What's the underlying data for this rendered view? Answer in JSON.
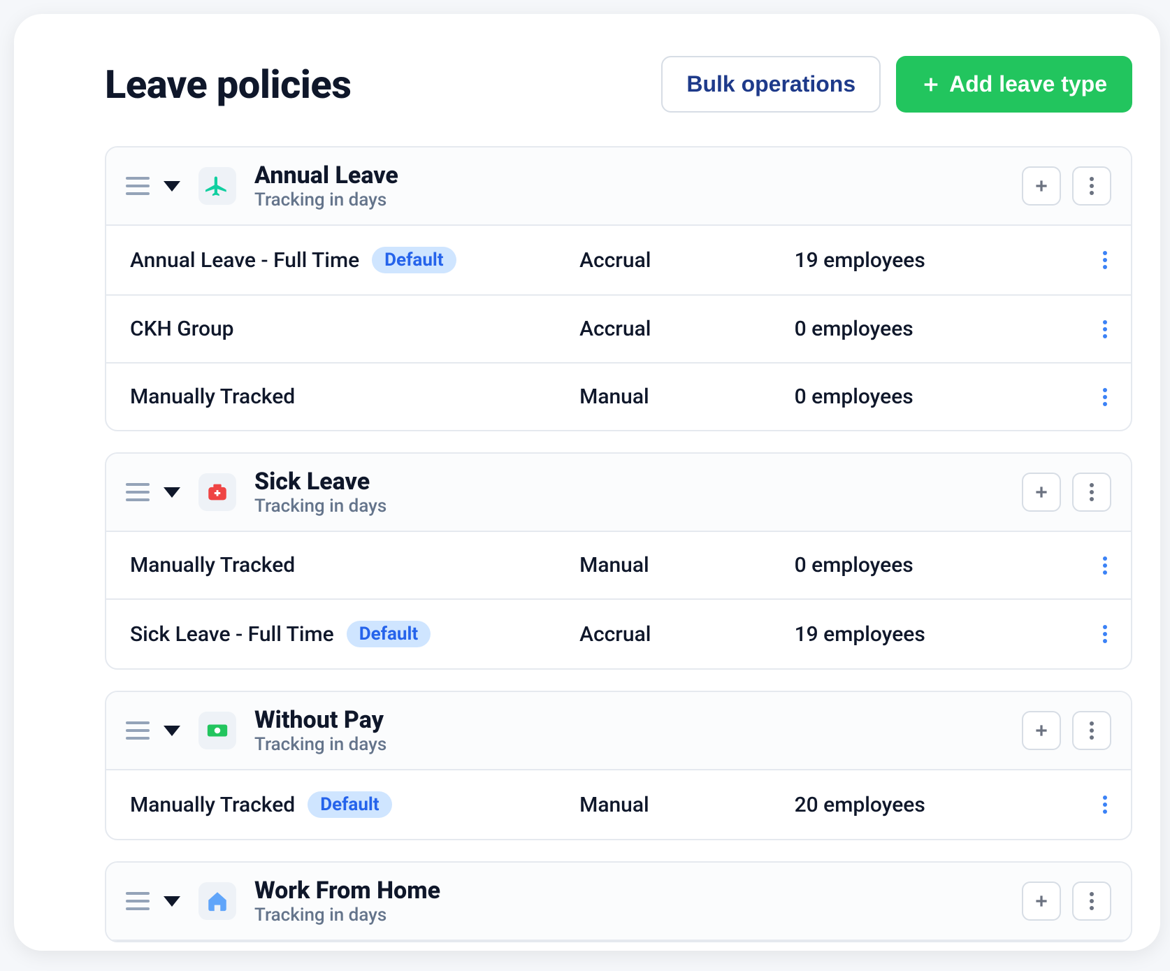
{
  "header": {
    "title": "Leave policies",
    "bulk_ops_label": "Bulk operations",
    "add_type_label": "Add leave type"
  },
  "badges": {
    "default": "Default"
  },
  "types": [
    {
      "title": "Annual Leave",
      "subtitle": "Tracking in days",
      "icon": "plane",
      "rows": [
        {
          "name": "Annual Leave - Full Time",
          "default": true,
          "method": "Accrual",
          "employees": "19 employees"
        },
        {
          "name": "CKH Group",
          "default": false,
          "method": "Accrual",
          "employees": "0 employees"
        },
        {
          "name": "Manually Tracked",
          "default": false,
          "method": "Manual",
          "employees": "0 employees"
        }
      ]
    },
    {
      "title": "Sick Leave",
      "subtitle": "Tracking in days",
      "icon": "medkit",
      "rows": [
        {
          "name": "Manually Tracked",
          "default": false,
          "method": "Manual",
          "employees": "0 employees"
        },
        {
          "name": "Sick Leave - Full Time",
          "default": true,
          "method": "Accrual",
          "employees": "19 employees"
        }
      ]
    },
    {
      "title": "Without Pay",
      "subtitle": "Tracking in days",
      "icon": "cash",
      "rows": [
        {
          "name": "Manually Tracked",
          "default": true,
          "method": "Manual",
          "employees": "20 employees"
        }
      ]
    },
    {
      "title": "Work From Home",
      "subtitle": "Tracking in days",
      "icon": "home",
      "rows": []
    }
  ]
}
